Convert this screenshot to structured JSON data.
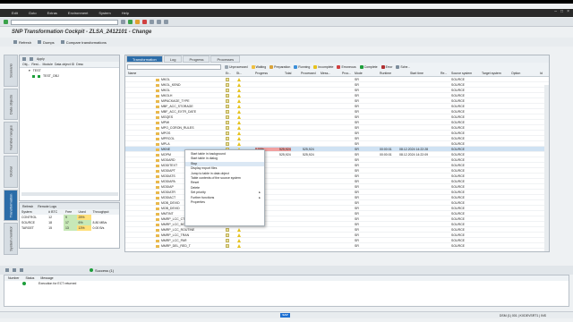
{
  "menubar": {
    "items": [
      "Edit",
      "Goto",
      "Extras",
      "Environment",
      "System",
      "Help"
    ]
  },
  "title": "SNP Transformation Cockpit - ZLSA_2412101 - Change",
  "toolbar": {
    "refresh": "Refresh",
    "dumps": "Dumps",
    "compare": "Compare transformations"
  },
  "vtabs": [
    "Scenario",
    "Data objects",
    "Number ranges",
    "Global",
    "Transformation",
    "System monitor"
  ],
  "left": {
    "apply": "Apply",
    "headers": [
      "Obj...",
      "Rest...",
      "Module",
      "Data object ID",
      "Desc"
    ],
    "rows": [
      {
        "label": "TEST"
      },
      {
        "label": "TEST_OBJ"
      }
    ]
  },
  "stats": {
    "refresh": "Refresh",
    "log": "Remote Logs",
    "headers": [
      "System",
      "# BTC",
      "Free",
      "Used",
      "Throughput"
    ],
    "rows": [
      {
        "system": "CONTROL",
        "btc": "12",
        "free": "9",
        "used": "25%",
        "tp": ""
      },
      {
        "system": "SOURCE",
        "btc": "18",
        "free": "17",
        "used": "6%",
        "tp": "8.80 MB/s"
      },
      {
        "system": "TARGET",
        "btc": "15",
        "free": "13",
        "used": "13%",
        "tp": "0.00 B/s"
      }
    ]
  },
  "main": {
    "tabs": [
      "Transformation",
      "Log",
      "Progress",
      "Processes"
    ],
    "filters": [
      "Unprocessed",
      "Waiting",
      "Preparation",
      "Running",
      "Incomplete",
      "Erroneous",
      "Complete",
      "Error",
      "Sche..."
    ],
    "columns": [
      "Name",
      "Er...",
      "St...",
      "Progress",
      "Total",
      "Processed",
      "Mess...",
      "Proc...",
      "Mode",
      "Runtime",
      "Start time",
      "Re...",
      "Source system",
      "Target system",
      "Option",
      "Id"
    ],
    "rows": [
      {
        "name": "MKOL",
        "mode": "SR",
        "src": "SOURCE"
      },
      {
        "name": "MKOL_KEND",
        "mode": "SR",
        "src": "SOURCE"
      },
      {
        "name": "MKOL",
        "mode": "SR",
        "src": "SOURCE"
      },
      {
        "name": "MKOLH",
        "mode": "SR",
        "src": "SOURCE"
      },
      {
        "name": "MIPACKAGE_TYPE",
        "mode": "SR",
        "src": "SOURCE"
      },
      {
        "name": "MBF_ACC_STORAGE",
        "mode": "SR",
        "src": "SOURCE"
      },
      {
        "name": "MBF_ACC_EXTR_DATE",
        "mode": "SR",
        "src": "SOURCE"
      },
      {
        "name": "MGQES",
        "mode": "SR",
        "src": "SOURCE"
      },
      {
        "name": "MPMI",
        "mode": "SR",
        "src": "SOURCE"
      },
      {
        "name": "MPO_CORON_RULES",
        "mode": "SR",
        "src": "SOURCE"
      },
      {
        "name": "MPOS",
        "mode": "SR",
        "src": "SOURCE"
      },
      {
        "name": "MPRCOL",
        "mode": "SR",
        "src": "SOURCE"
      },
      {
        "name": "MPLA",
        "mode": "SR",
        "src": "SOURCE"
      },
      {
        "name": "MKNE",
        "progress": "0.00%",
        "total": "525,924",
        "processed": "525,924",
        "mode": "SR",
        "runtime": "00:00:01",
        "start": "08.12.2024 14:22:28",
        "src": "SOURCE",
        "sel": true
      },
      {
        "name": "MOPM",
        "total": "525,924",
        "processed": "525,924",
        "mode": "SR",
        "runtime": "00:00:01",
        "start": "08.12.2024 14:22:09",
        "src": "SOURCE"
      },
      {
        "name": "MODARD",
        "mode": "SR",
        "src": "SOURCE"
      },
      {
        "name": "MODITEXT",
        "mode": "SR",
        "src": "SOURCE"
      },
      {
        "name": "MODIAPT",
        "mode": "SR",
        "src": "SOURCE"
      },
      {
        "name": "MODIATS",
        "mode": "SR",
        "src": "SOURCE"
      },
      {
        "name": "MODIAPA",
        "mode": "SR",
        "src": "SOURCE"
      },
      {
        "name": "MODIAP",
        "mode": "SR",
        "src": "SOURCE"
      },
      {
        "name": "MODIATR",
        "mode": "SR",
        "src": "SOURCE"
      },
      {
        "name": "MODIACT",
        "mode": "SR",
        "src": "SOURCE"
      },
      {
        "name": "MOB_DEVID",
        "mode": "SR",
        "src": "SOURCE"
      },
      {
        "name": "MOB_DEVID",
        "mode": "SR",
        "src": "SOURCE"
      },
      {
        "name": "MMTINT",
        "mode": "SR",
        "src": "SOURCE"
      },
      {
        "name": "MMRP_LCC_CTL",
        "mode": "SR",
        "src": "SOURCE"
      },
      {
        "name": "MMRP_LCC_BOM",
        "mode": "SR",
        "src": "SOURCE"
      },
      {
        "name": "MMRP_LCC_ROUTINE",
        "mode": "SR",
        "src": "SOURCE"
      },
      {
        "name": "MMRP_LCC_TRAN",
        "mode": "SR",
        "src": "SOURCE"
      },
      {
        "name": "MMRP_LCC_PAR",
        "mode": "SR",
        "src": "SOURCE"
      },
      {
        "name": "MMRP_DEL_RED_T",
        "mode": "SR",
        "src": "SOURCE"
      }
    ]
  },
  "context_menu": {
    "items": [
      {
        "label": "Start table in background"
      },
      {
        "label": "Start table in dialog"
      },
      {
        "label": "Stop"
      },
      {
        "label": "Display export files"
      },
      {
        "label": "Jump to table in data object"
      },
      {
        "label": "Table contents of the source system"
      },
      {
        "label": "Reset"
      },
      {
        "label": "Delete"
      },
      {
        "label": "Set priority",
        "arrow": "▸"
      },
      {
        "label": "Further functions",
        "arrow": "▸"
      },
      {
        "label": "Properties"
      }
    ]
  },
  "bottom": {
    "success": "Success (1)"
  },
  "messages": {
    "headers": [
      "Number",
      "Status",
      "Message"
    ],
    "rows": [
      {
        "text": "Execution for ECT returned"
      }
    ]
  },
  "statusbar": {
    "logo": "SAP",
    "system": "DSM (1) 001 | KXDEVSRT1 | INS"
  },
  "colors": {
    "accent": "#2b6ca8",
    "warning": "#e7c21b",
    "success": "#1d9e3a"
  }
}
